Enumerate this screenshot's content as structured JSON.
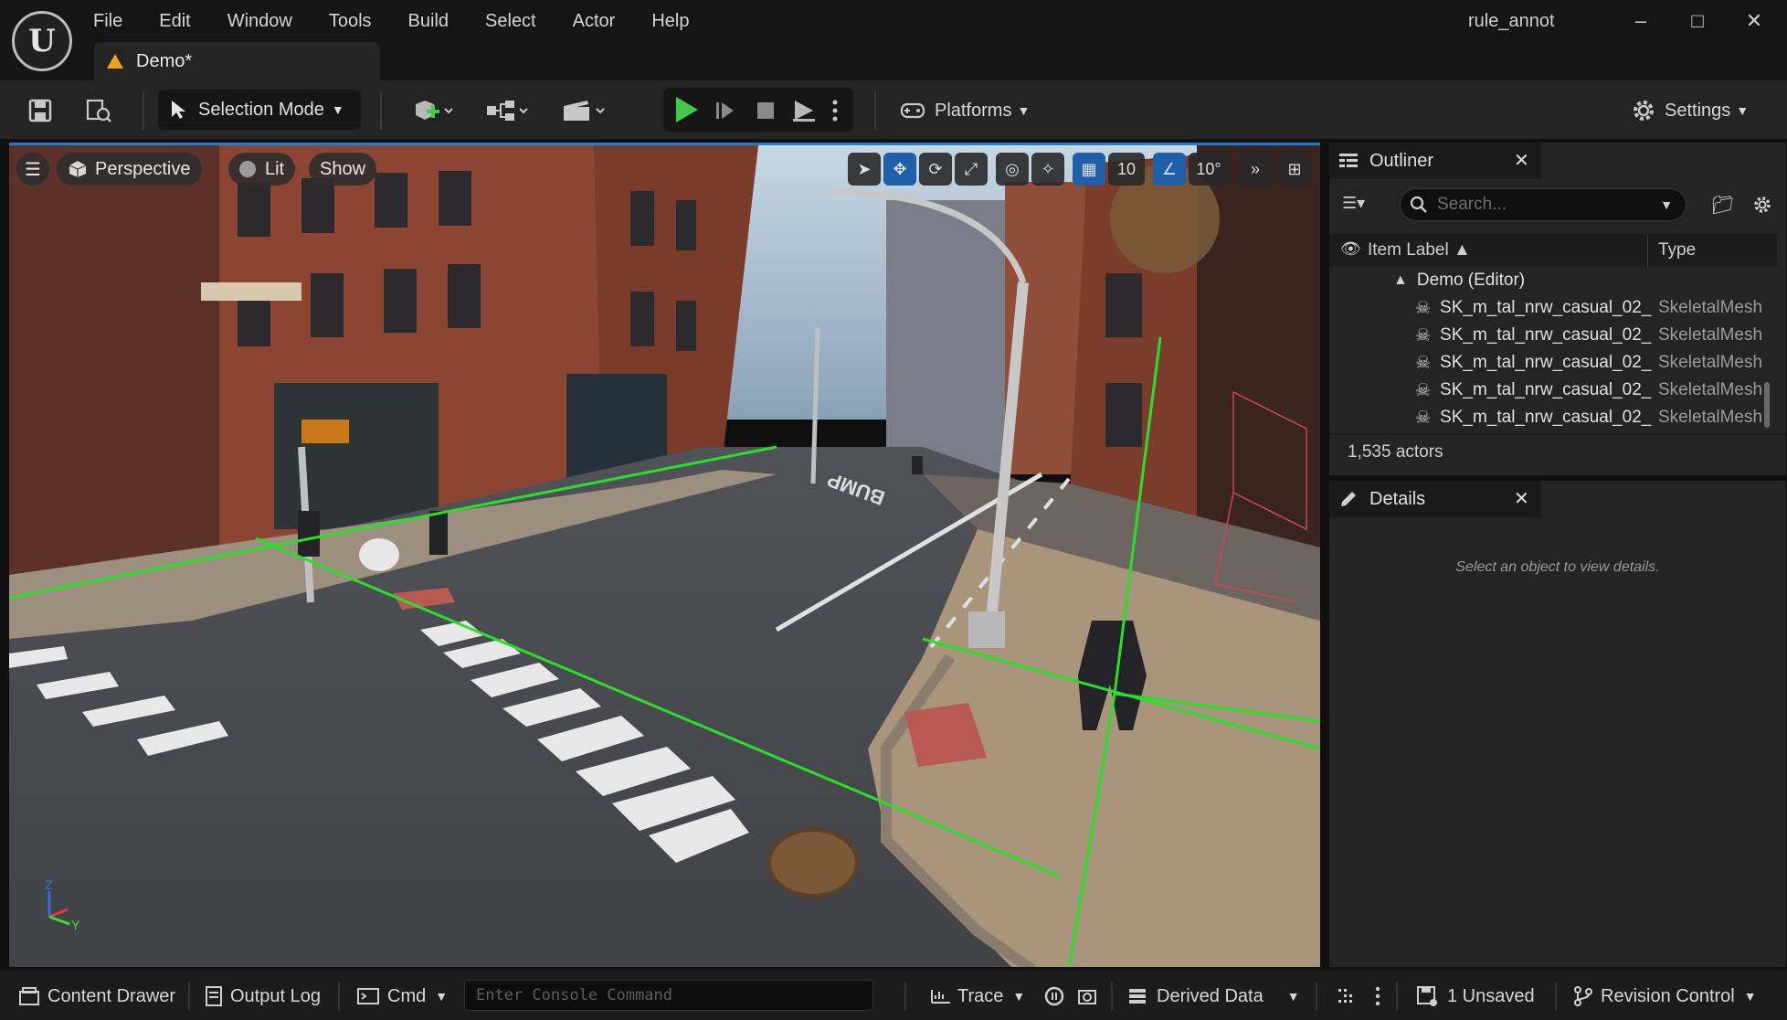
{
  "titlebar": {
    "logo": "unreal-logo",
    "menu": [
      "File",
      "Edit",
      "Window",
      "Tools",
      "Build",
      "Select",
      "Actor",
      "Help"
    ],
    "document_tab": "Demo*",
    "window_title": "rule_annot",
    "controls": {
      "minimize": "–",
      "maximize": "□",
      "close": "✕"
    }
  },
  "toolbar": {
    "selection_mode": "Selection Mode",
    "platforms": "Platforms",
    "settings": "Settings",
    "icons": [
      "save-icon",
      "browse-icon",
      "add-actor-icon",
      "blueprint-icon",
      "cinematics-icon",
      "play-icon",
      "advance-frame-icon",
      "stop-icon",
      "eject-icon",
      "more-icon"
    ]
  },
  "viewport": {
    "menu_icon": "hamburger-icon",
    "view_mode": "Perspective",
    "lighting": "Lit",
    "show": "Show",
    "grid_snap": "10",
    "angle_snap": "10°",
    "road_text": "BUMP",
    "axis": {
      "z": "Z",
      "y": "Y"
    }
  },
  "outliner": {
    "title": "Outliner",
    "search_placeholder": "Search...",
    "columns": {
      "label": "Item Label",
      "type": "Type"
    },
    "root": "Demo (Editor)",
    "rows": [
      {
        "label": "SK_m_tal_nrw_casual_02_",
        "type": "SkeletalMesh"
      },
      {
        "label": "SK_m_tal_nrw_casual_02_",
        "type": "SkeletalMesh"
      },
      {
        "label": "SK_m_tal_nrw_casual_02_",
        "type": "SkeletalMesh"
      },
      {
        "label": "SK_m_tal_nrw_casual_02_",
        "type": "SkeletalMesh"
      },
      {
        "label": "SK_m_tal_nrw_casual_02_",
        "type": "SkeletalMesh"
      }
    ],
    "actor_count": "1,535 actors"
  },
  "details": {
    "title": "Details",
    "empty_message": "Select an object to view details."
  },
  "statusbar": {
    "content_drawer": "Content Drawer",
    "output_log": "Output Log",
    "cmd": "Cmd",
    "console_placeholder": "Enter Console Command",
    "trace": "Trace",
    "derived_data": "Derived Data",
    "unsaved": "1 Unsaved",
    "revision_control": "Revision Control"
  },
  "colors": {
    "accent": "#1b7fd6",
    "play_green": "#42c84a",
    "warning_orange": "#f0a020"
  }
}
